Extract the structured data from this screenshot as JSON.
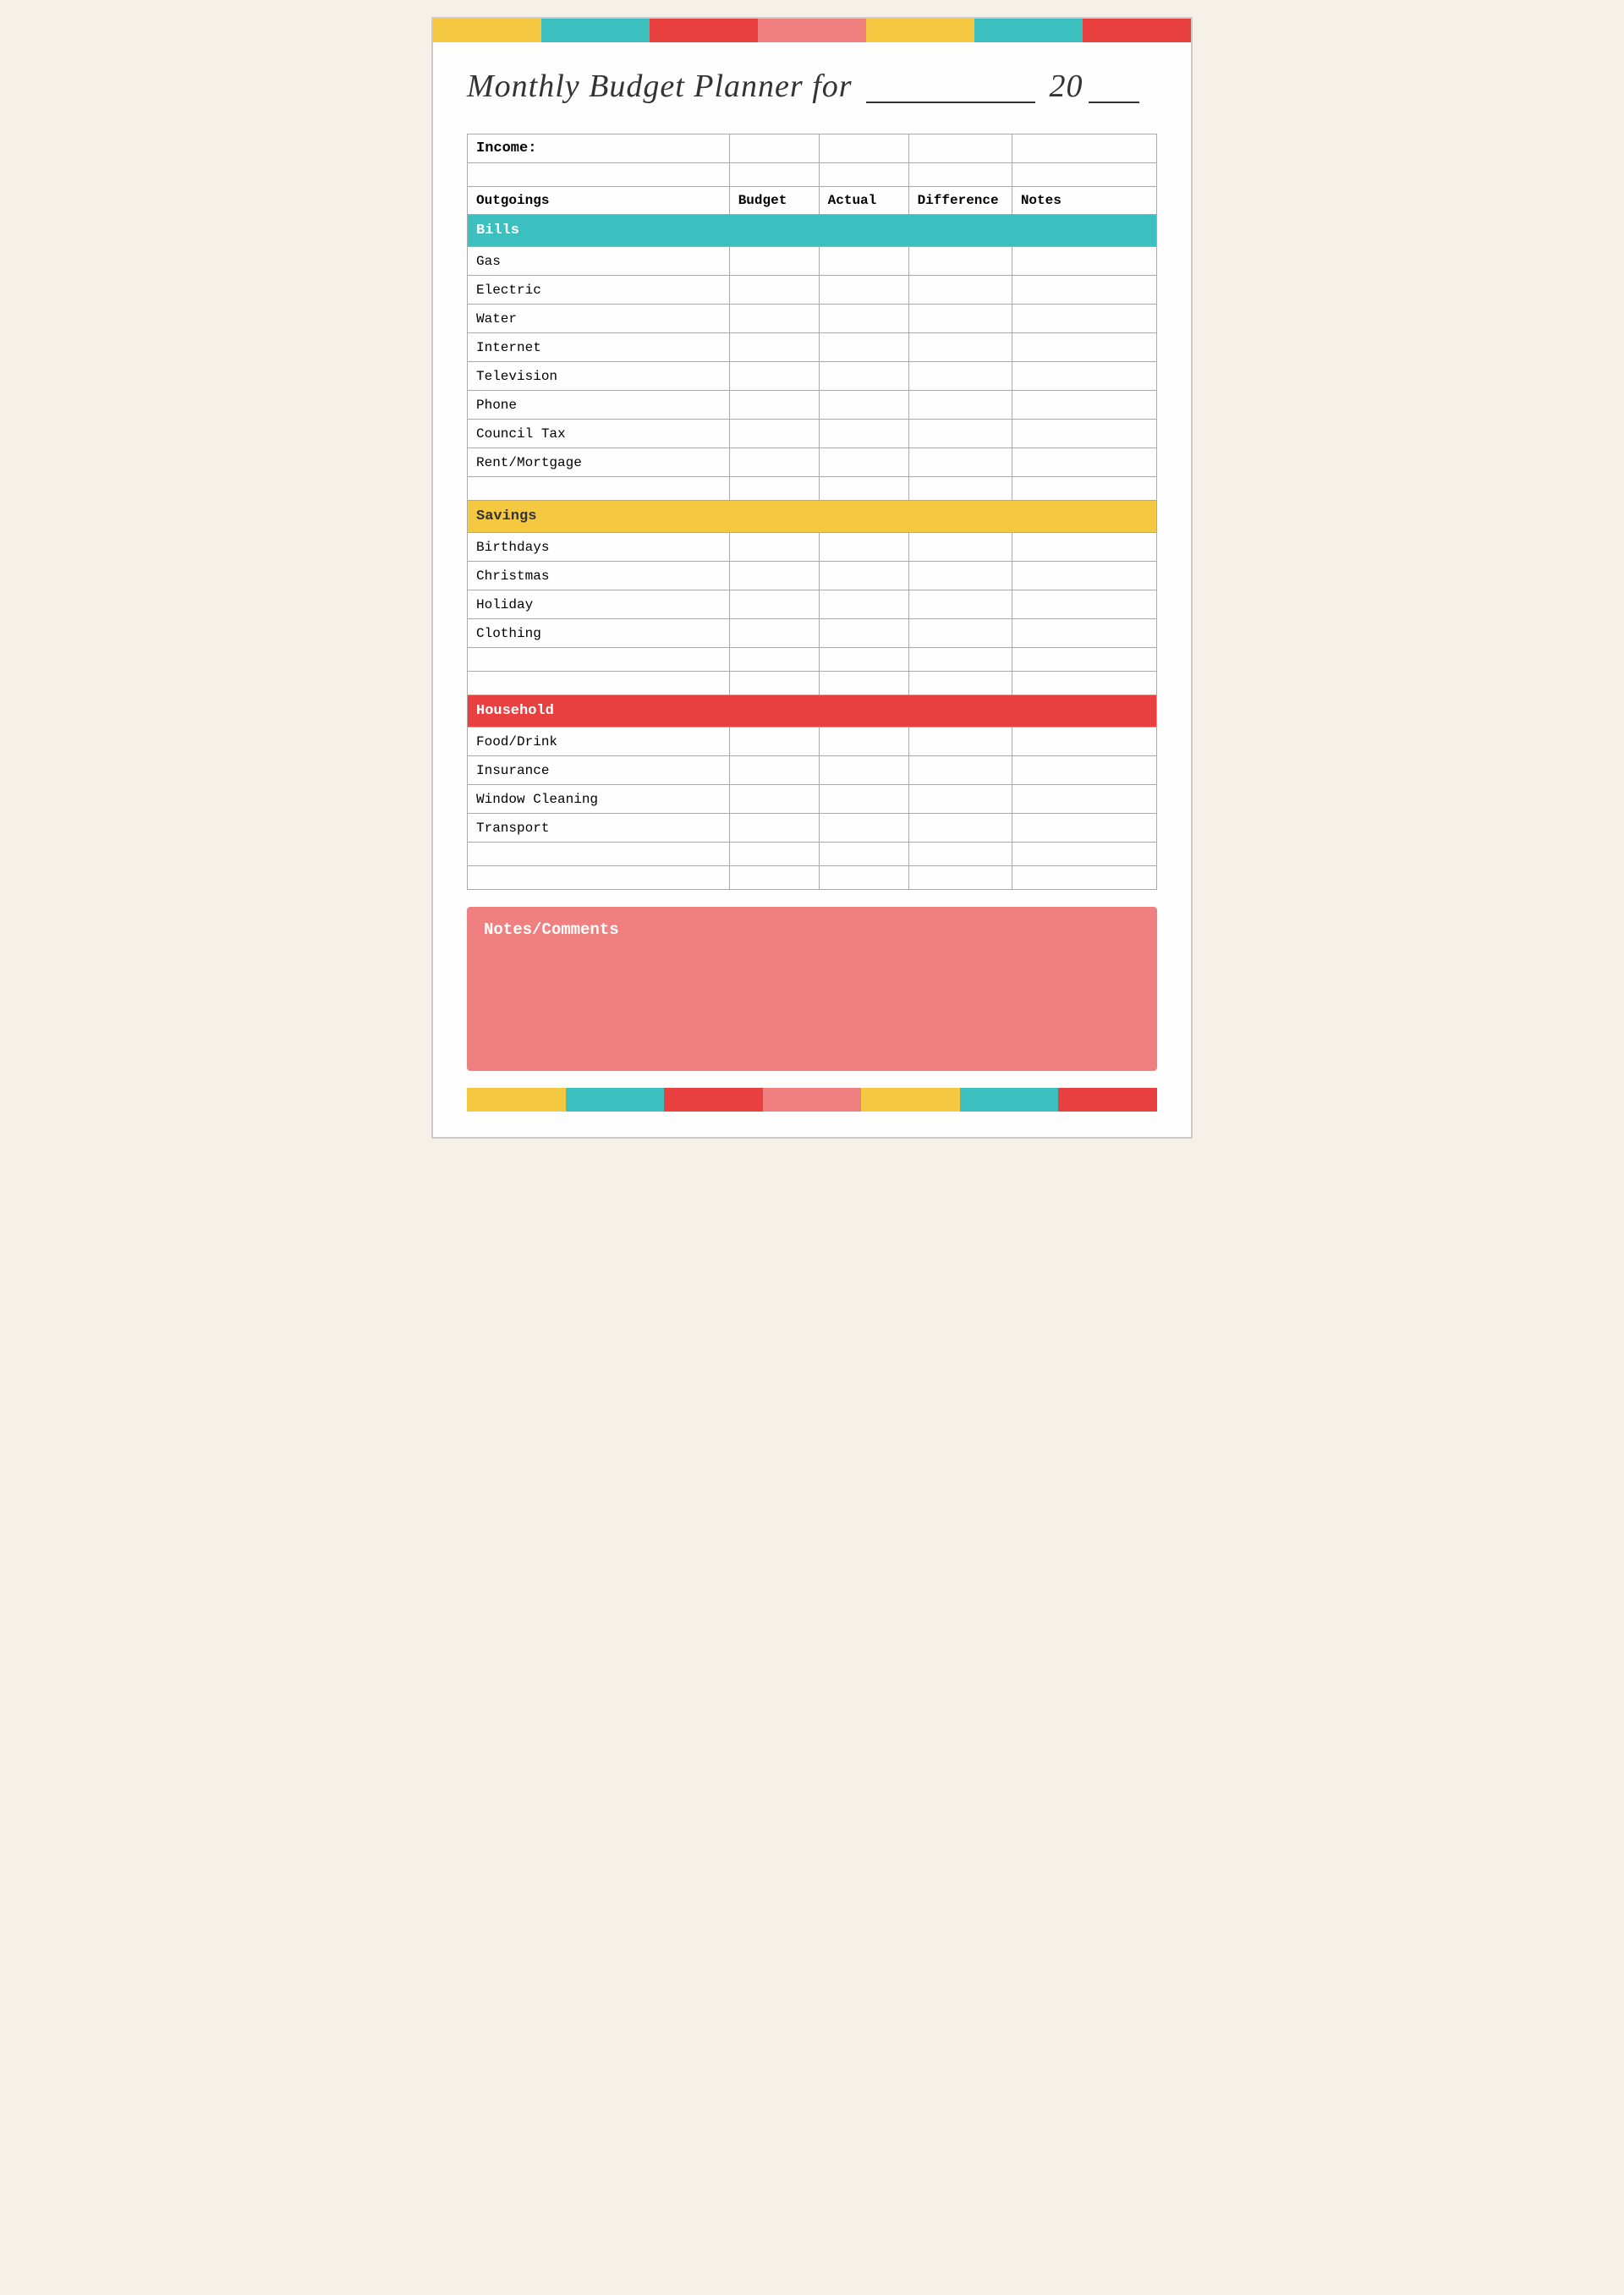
{
  "title": {
    "main": "Monthly Budget Planner for",
    "year_prefix": "20",
    "year_suffix": "__"
  },
  "color_bars": {
    "segments": [
      "yellow",
      "teal",
      "red",
      "pink",
      "yellow",
      "teal",
      "red"
    ]
  },
  "table": {
    "income_label": "Income:",
    "headers": {
      "outgoings": "Outgoings",
      "budget": "Budget",
      "actual": "Actual",
      "difference": "Difference",
      "notes": "Notes"
    },
    "sections": {
      "bills": {
        "label": "Bills",
        "rows": [
          "Gas",
          "Electric",
          "Water",
          "Internet",
          "Television",
          "Phone",
          "Council Tax",
          "Rent/Mortgage"
        ]
      },
      "savings": {
        "label": "Savings",
        "rows": [
          "Birthdays",
          "Christmas",
          "Holiday",
          "Clothing"
        ]
      },
      "household": {
        "label": "Household",
        "rows": [
          "Food/Drink",
          "Insurance",
          "Window Cleaning",
          "Transport"
        ]
      }
    }
  },
  "notes_section": {
    "label": "Notes/Comments"
  }
}
